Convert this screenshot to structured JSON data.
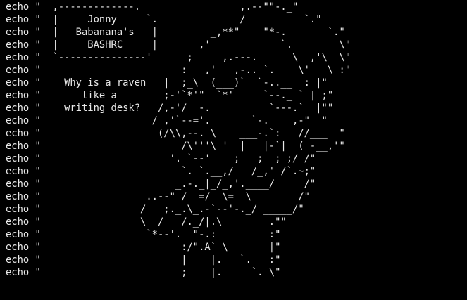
{
  "editor": {
    "lines": [
      "echo \"  ,-------------.                 ,.--\"\"-._\"",
      "echo \"  |     Jonny     `.            __/          `.\"",
      "echo \"  |   Babanana's   |         _,**\"    \"*-.       `.\"",
      "echo \"  |     BASHRC     |       ,'            `.        \\\"",
      "echo \"  `---------------'      ;    _,.---._     \\  ,'\\  \\\"",
      "echo \"                        :   ,'   ,-.. `.    \\'   \\ :\"",
      "echo \"    Why is a raven   |  ;_\\  (___)`  `-..__  : |\"",
      "echo \"       like a        ;-'`*'\"  `*'     `--._ ` | ;\"",
      "echo \"    writing desk?   /,-'/  -.          `---.`  |\"\"",
      "echo \"                   /_,'`--='.       `-._  _,-\" _\"",
      "echo \"                    (/\\\\,--. \\    ___-.`:   //___  \"",
      "echo \"                        /\\'''\\ '  |   |-`|  ( -__,'\"",
      "echo \"                      '. `--'    ;   ;  ; ;/_/\"",
      "echo \"                        `. `.__,/   /_,' /`.~;\"",
      "echo \"                       _.-._|_/_,'.____/     /\"",
      "echo \"                  ..--\" /  =/  \\=  \\        /\"",
      "echo \"                 /   ;._.\\_.-`--'-._/ _____/\"",
      "echo \"                 \\  /   /._/|.\\        .\"\"",
      "echo \"                  `*--'._ \"-.:         :\"",
      "echo \"                        :/\".A` \\       |\"",
      "echo \"                        |    |.   `.   :\"",
      "echo \"                        ;    |.     `. \\\""
    ]
  }
}
